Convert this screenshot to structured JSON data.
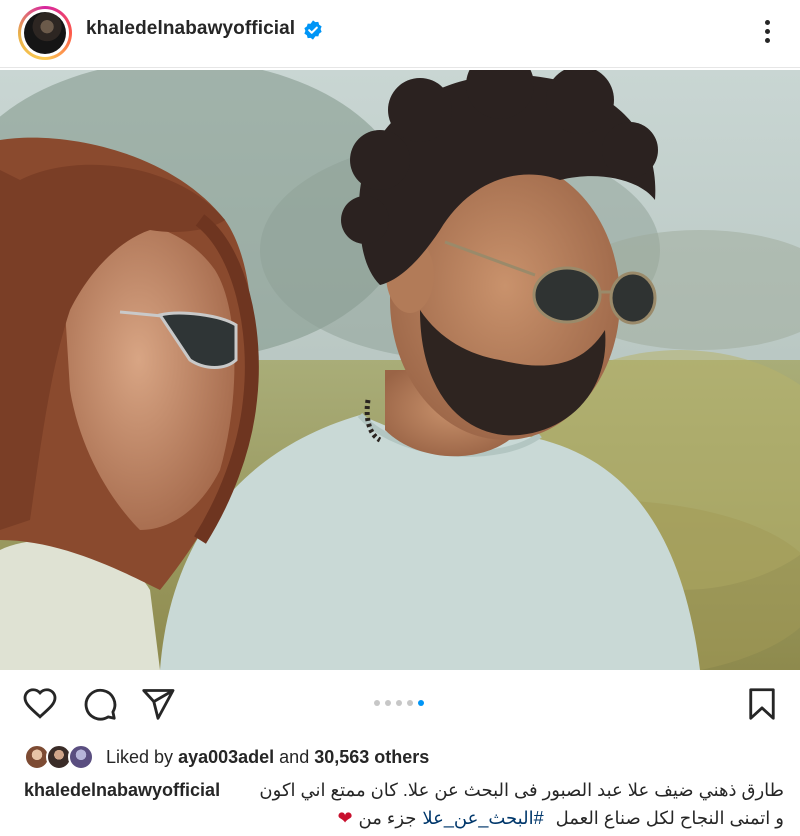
{
  "post": {
    "username": "khaledelnabawyofficial",
    "verified": true,
    "icons": {
      "verified": "verified-badge-icon",
      "more": "more-options-icon",
      "like": "heart-icon",
      "comment": "comment-icon",
      "share": "paper-plane-icon",
      "save": "bookmark-icon"
    },
    "carousel": {
      "total": 5,
      "active": 5
    },
    "likes": {
      "prefix": "Liked by",
      "liker": "aya003adel",
      "middle": "and",
      "count": "30,563 others"
    },
    "caption": {
      "username": "khaledelnabawyofficial",
      "line1": "طارق ذهني ضيف علا عبد الصبور فى البحث عن علا. كان ممتع اني اكون",
      "line2_pre": "جزء من",
      "hashtag": "#البحث_عن_علا",
      "line2_post": "و اتمنى النجاح لكل صناع العمل",
      "emoji": "❤"
    },
    "colors": {
      "accent": "#0095f6",
      "text": "#262626",
      "hashtag": "#00376b",
      "heart_emoji": "#c8102e"
    }
  }
}
